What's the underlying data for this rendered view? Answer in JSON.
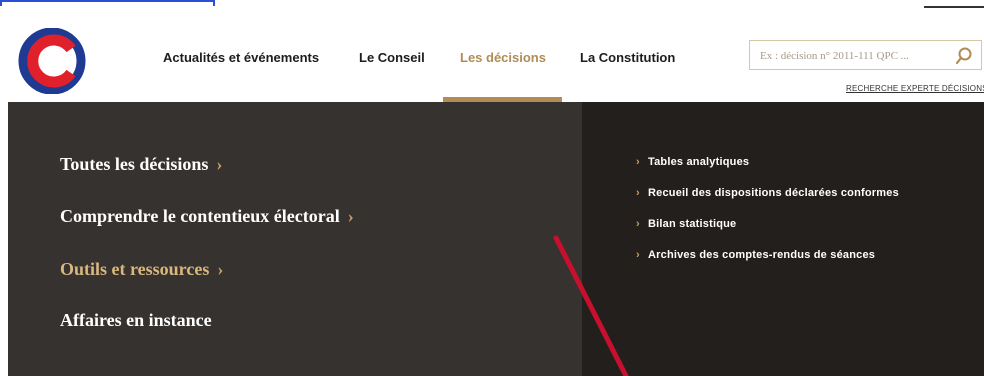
{
  "colors": {
    "accent_gold": "#b08d57",
    "logo_red": "#e0202b",
    "logo_blue": "#1f3a93",
    "menu_bg": "#353230",
    "menu_right_bg": "#231f1d",
    "annotation_red": "#c8102e"
  },
  "header": {
    "nav": [
      {
        "label": "Actualités et événements",
        "active": false
      },
      {
        "label": "Le Conseil",
        "active": false
      },
      {
        "label": "Les décisions",
        "active": true
      },
      {
        "label": "La Constitution",
        "active": false
      }
    ],
    "search": {
      "placeholder": "Ex : décision n° 2011-111 QPC ...",
      "icon": "search-icon",
      "expert_link": "RECHERCHE EXPERTE DÉCISIONS"
    }
  },
  "menu": {
    "main_links": [
      {
        "label": "Toutes les décisions",
        "chevron": "›",
        "highlight": false
      },
      {
        "label": "Comprendre le contentieux électoral",
        "chevron": "›",
        "highlight": false
      },
      {
        "label": "Outils et ressources",
        "chevron": "›",
        "highlight": true
      },
      {
        "label": "Affaires en instance",
        "chevron": "",
        "highlight": false
      }
    ],
    "sub_links": [
      {
        "label": "Tables analytiques",
        "chevron": "›"
      },
      {
        "label": "Recueil des dispositions déclarées conformes",
        "chevron": "›"
      },
      {
        "label": "Bilan statistique",
        "chevron": "›"
      },
      {
        "label": "Archives des comptes-rendus de séances",
        "chevron": "›"
      }
    ]
  }
}
